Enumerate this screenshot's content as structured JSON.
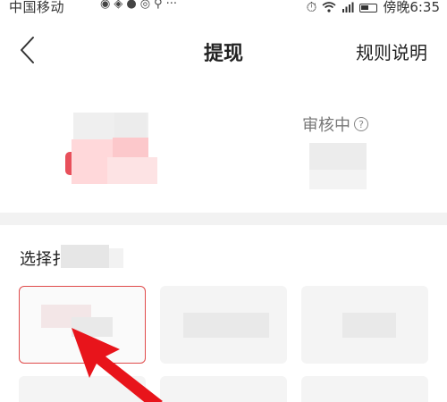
{
  "status_bar": {
    "carrier": "中国移动",
    "time": "傍晚6:35"
  },
  "nav": {
    "title": "提现",
    "rules_label": "规则说明"
  },
  "balance": {
    "status_label": "审核中",
    "help_symbol": "?"
  },
  "amount_section": {
    "label": "选择扌"
  },
  "colors": {
    "accent": "#e04a4a",
    "arrow": "#e8141b",
    "divider": "#f2f2f2"
  }
}
